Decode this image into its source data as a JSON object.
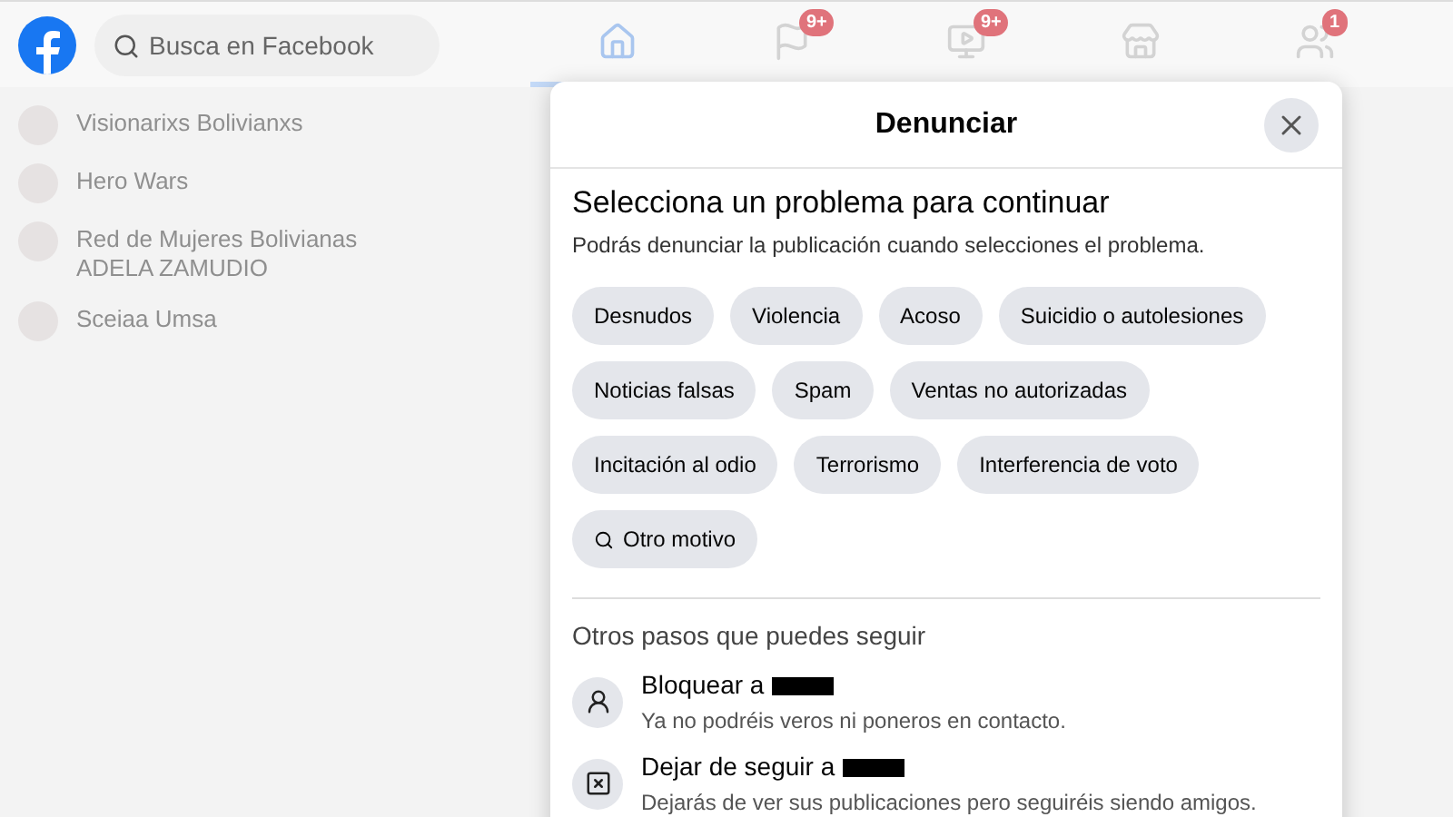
{
  "topbar": {
    "search": {
      "placeholder": "Busca en Facebook"
    },
    "nav": [
      {
        "kind": "home",
        "selected": true
      },
      {
        "kind": "flag",
        "badge": "9+",
        "selected": false
      },
      {
        "kind": "video",
        "badge": "9+",
        "selected": false
      },
      {
        "kind": "store",
        "selected": false
      },
      {
        "kind": "groups",
        "badge": "1",
        "selected": false
      }
    ]
  },
  "sidebar": {
    "items": [
      {
        "label": "Visionarixs Bolivianxs"
      },
      {
        "label": "Hero Wars"
      },
      {
        "label": "Red de Mujeres Bolivianas ADELA ZAMUDIO"
      },
      {
        "label": "Sceiaa Umsa"
      }
    ]
  },
  "dialog": {
    "title": "Denunciar",
    "heading": "Selecciona un problema para continuar",
    "subtitle": "Podrás denunciar la publicación cuando selecciones el problema.",
    "options": [
      [
        {
          "kind": "plain",
          "label": "Desnudos"
        },
        {
          "kind": "plain",
          "label": "Violencia"
        },
        {
          "kind": "plain",
          "label": "Acoso"
        },
        {
          "kind": "plain",
          "label": "Suicidio o autolesiones"
        }
      ],
      [
        {
          "kind": "plain",
          "label": "Noticias falsas"
        },
        {
          "kind": "plain",
          "label": "Spam"
        },
        {
          "kind": "plain",
          "label": "Ventas no autorizadas"
        }
      ],
      [
        {
          "kind": "plain",
          "label": "Incitación al odio"
        },
        {
          "kind": "plain",
          "label": "Terrorismo"
        },
        {
          "kind": "plain",
          "label": "Interferencia de voto"
        }
      ],
      [
        {
          "kind": "search",
          "label": "Otro motivo"
        }
      ]
    ],
    "other_steps_title": "Otros pasos que puedes seguir",
    "steps": [
      {
        "kind": "block",
        "title": "Bloquear a",
        "description": "Ya no podréis veros ni poneros en contacto."
      },
      {
        "kind": "unfollow",
        "title": "Dejar de seguir a",
        "description": "Dejarás de ver sus publicaciones pero seguiréis siendo amigos."
      }
    ]
  }
}
